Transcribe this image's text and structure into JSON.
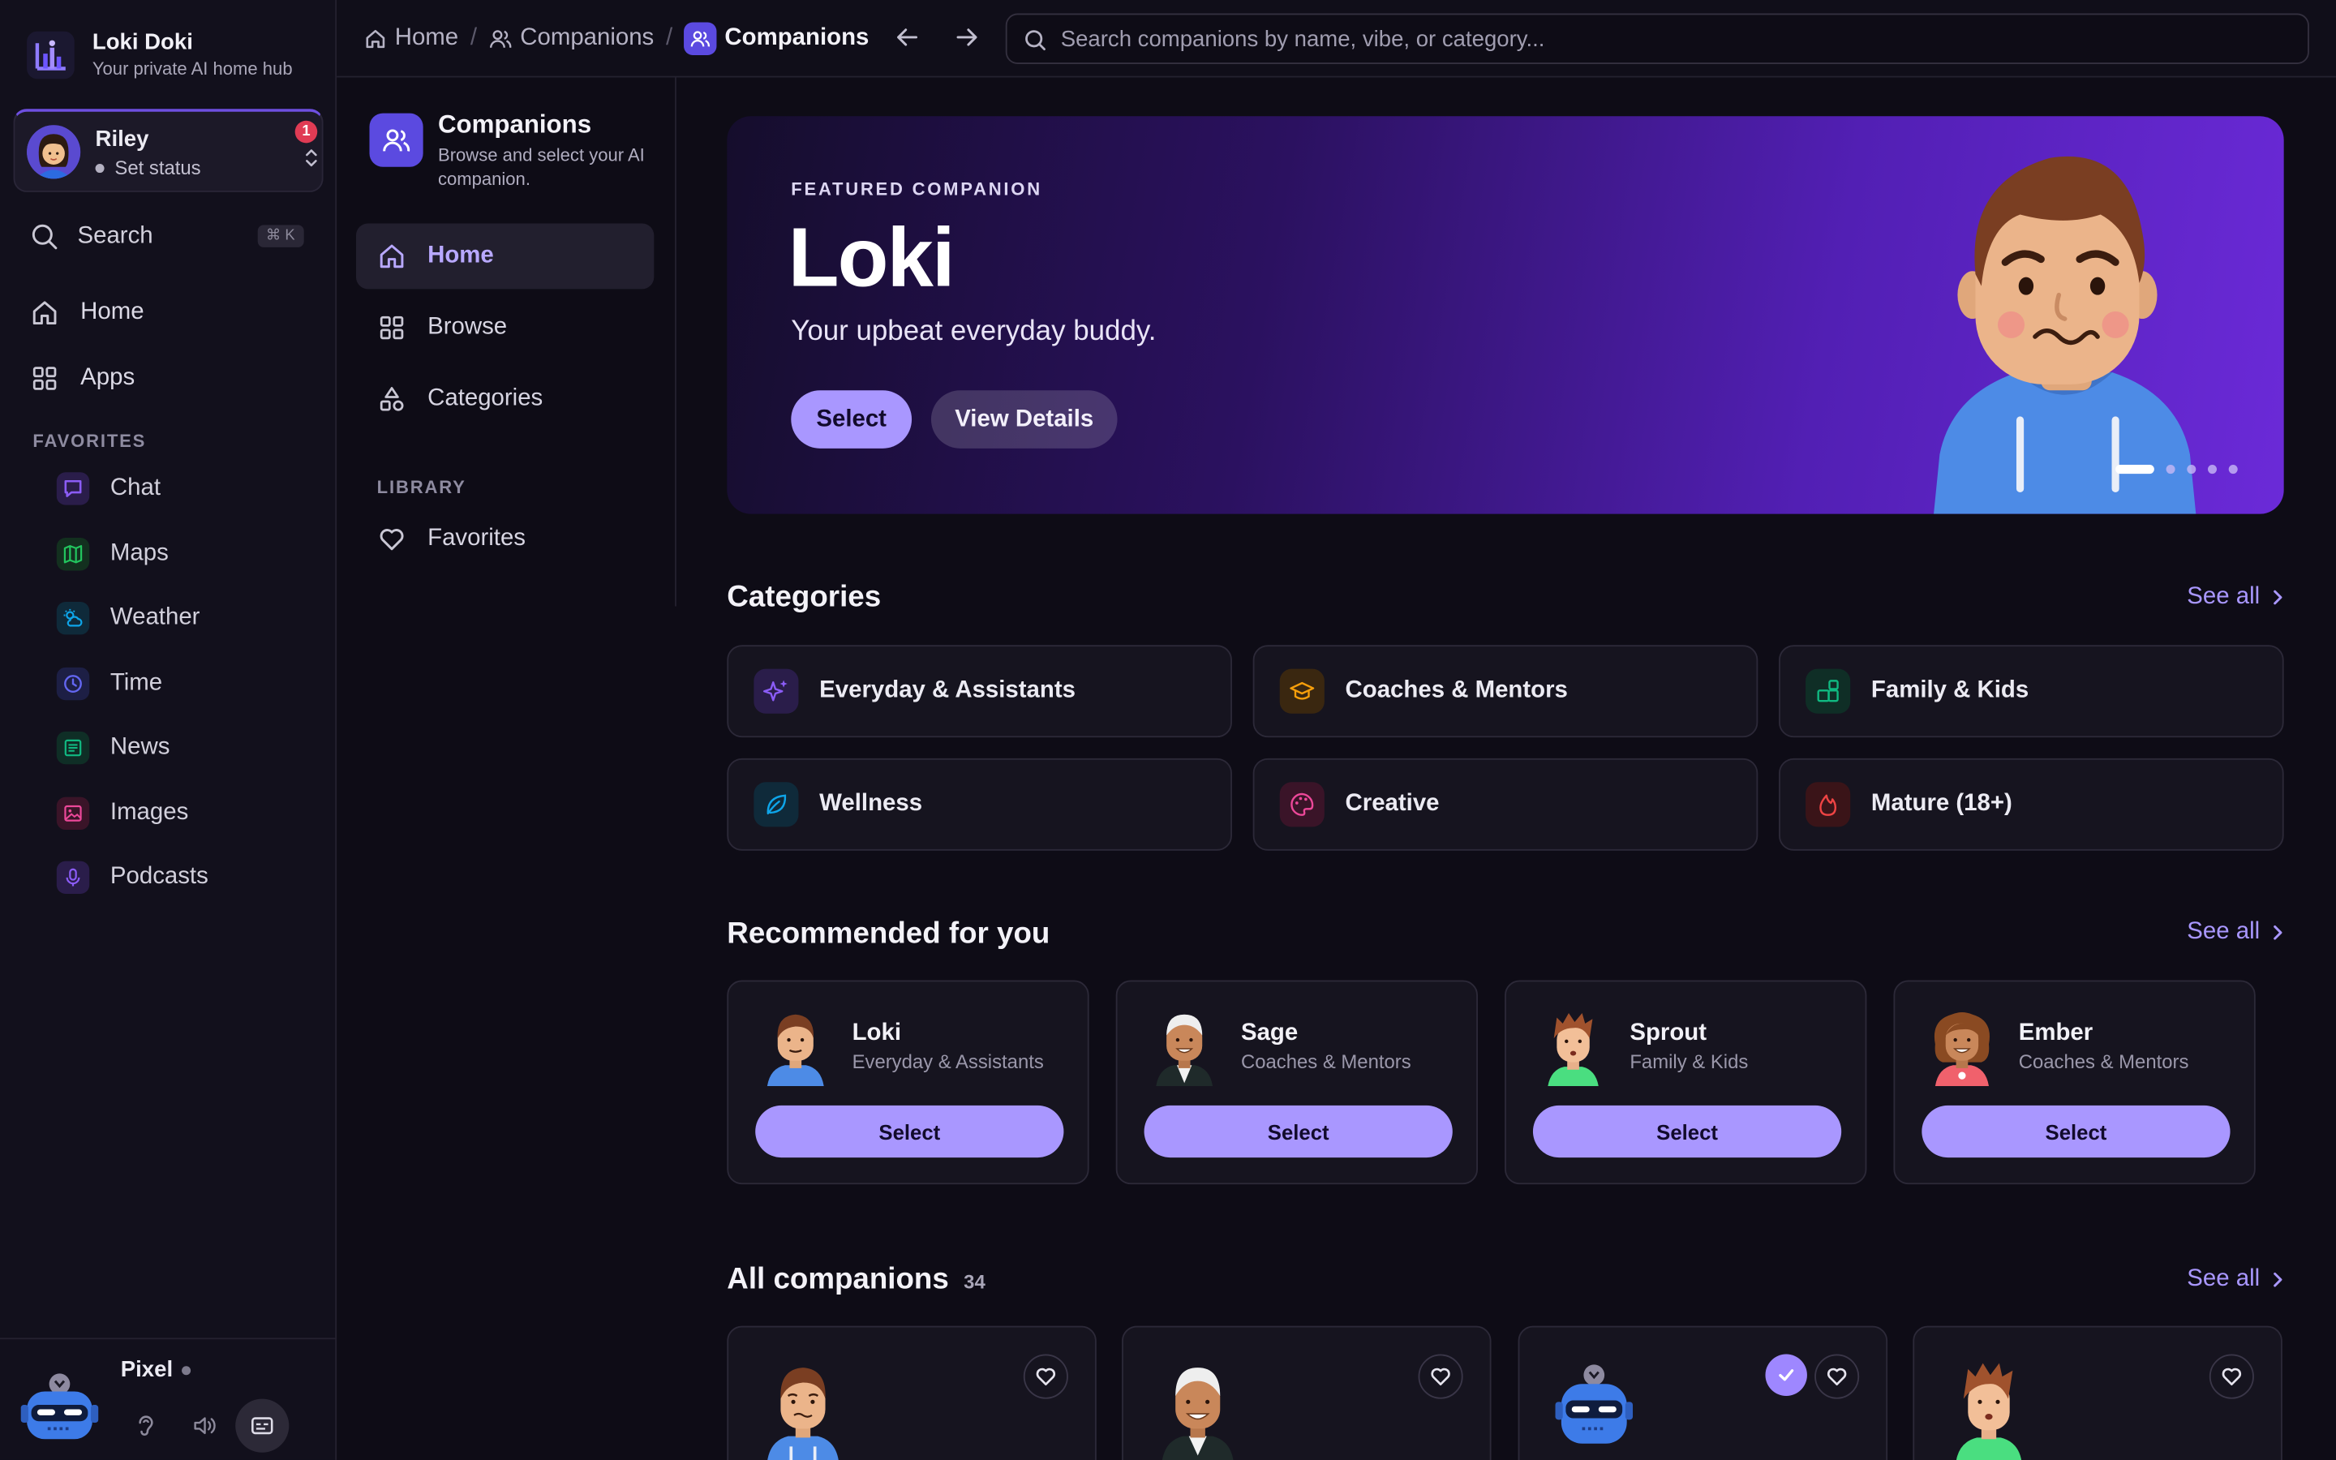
{
  "app": {
    "name": "Loki Doki",
    "tagline": "Your private AI home hub"
  },
  "user": {
    "name": "Riley",
    "status": "Set status",
    "notifications": "1"
  },
  "sidebar": {
    "search_label": "Search",
    "search_shortcut": "⌘ K",
    "nav": [
      {
        "label": "Home",
        "icon": "home-icon"
      },
      {
        "label": "Apps",
        "icon": "grid-icon"
      }
    ],
    "favorites_title": "FAVORITES",
    "favorites": [
      {
        "label": "Chat",
        "icon": "chat-icon",
        "color": "#8b5cf6"
      },
      {
        "label": "Maps",
        "icon": "map-icon",
        "color": "#22c55e"
      },
      {
        "label": "Weather",
        "icon": "weather-icon",
        "color": "#0ea5e9"
      },
      {
        "label": "Time",
        "icon": "clock-icon",
        "color": "#6366f1"
      },
      {
        "label": "News",
        "icon": "news-icon",
        "color": "#10b981"
      },
      {
        "label": "Images",
        "icon": "image-icon",
        "color": "#ec4899"
      },
      {
        "label": "Podcasts",
        "icon": "mic-icon",
        "color": "#8b5cf6"
      }
    ]
  },
  "assistant": {
    "name": "Pixel"
  },
  "breadcrumbs": [
    {
      "label": "Home"
    },
    {
      "label": "Companions"
    },
    {
      "label": "Companions"
    }
  ],
  "search": {
    "placeholder": "Search companions by name, vibe, or category..."
  },
  "subnav": {
    "title": "Companions",
    "description": "Browse and select your AI companion.",
    "items": [
      {
        "label": "Home",
        "icon": "home-icon"
      },
      {
        "label": "Browse",
        "icon": "grid-icon"
      },
      {
        "label": "Categories",
        "icon": "shapes-icon"
      }
    ],
    "library_title": "LIBRARY",
    "library_items": [
      {
        "label": "Favorites",
        "icon": "heart-icon"
      }
    ]
  },
  "hero": {
    "kicker": "FEATURED COMPANION",
    "name": "Loki",
    "tagline": "Your upbeat everyday buddy.",
    "primary": "Select",
    "secondary": "View Details",
    "slide_count": 5,
    "active_slide": 1
  },
  "categories": {
    "title": "Categories",
    "see_all": "See all",
    "items": [
      {
        "label": "Everyday & Assistants",
        "icon": "sparkles-icon",
        "color": "#8b5cf6"
      },
      {
        "label": "Coaches & Mentors",
        "icon": "graduation-cap-icon",
        "color": "#f59e0b"
      },
      {
        "label": "Family & Kids",
        "icon": "blocks-icon",
        "color": "#10b981"
      },
      {
        "label": "Wellness",
        "icon": "leaf-icon",
        "color": "#0ea5e9"
      },
      {
        "label": "Creative",
        "icon": "palette-icon",
        "color": "#ec4899"
      },
      {
        "label": "Mature (18+)",
        "icon": "flame-icon",
        "color": "#ef4444"
      }
    ]
  },
  "recommended": {
    "title": "Recommended for you",
    "see_all": "See all",
    "items": [
      {
        "name": "Loki",
        "category": "Everyday & Assistants",
        "button": "Select"
      },
      {
        "name": "Sage",
        "category": "Coaches & Mentors",
        "button": "Select"
      },
      {
        "name": "Sprout",
        "category": "Family & Kids",
        "button": "Select"
      },
      {
        "name": "Ember",
        "category": "Coaches & Mentors",
        "button": "Select"
      }
    ]
  },
  "all_companions": {
    "title": "All companions",
    "count": "34",
    "see_all": "See all"
  }
}
